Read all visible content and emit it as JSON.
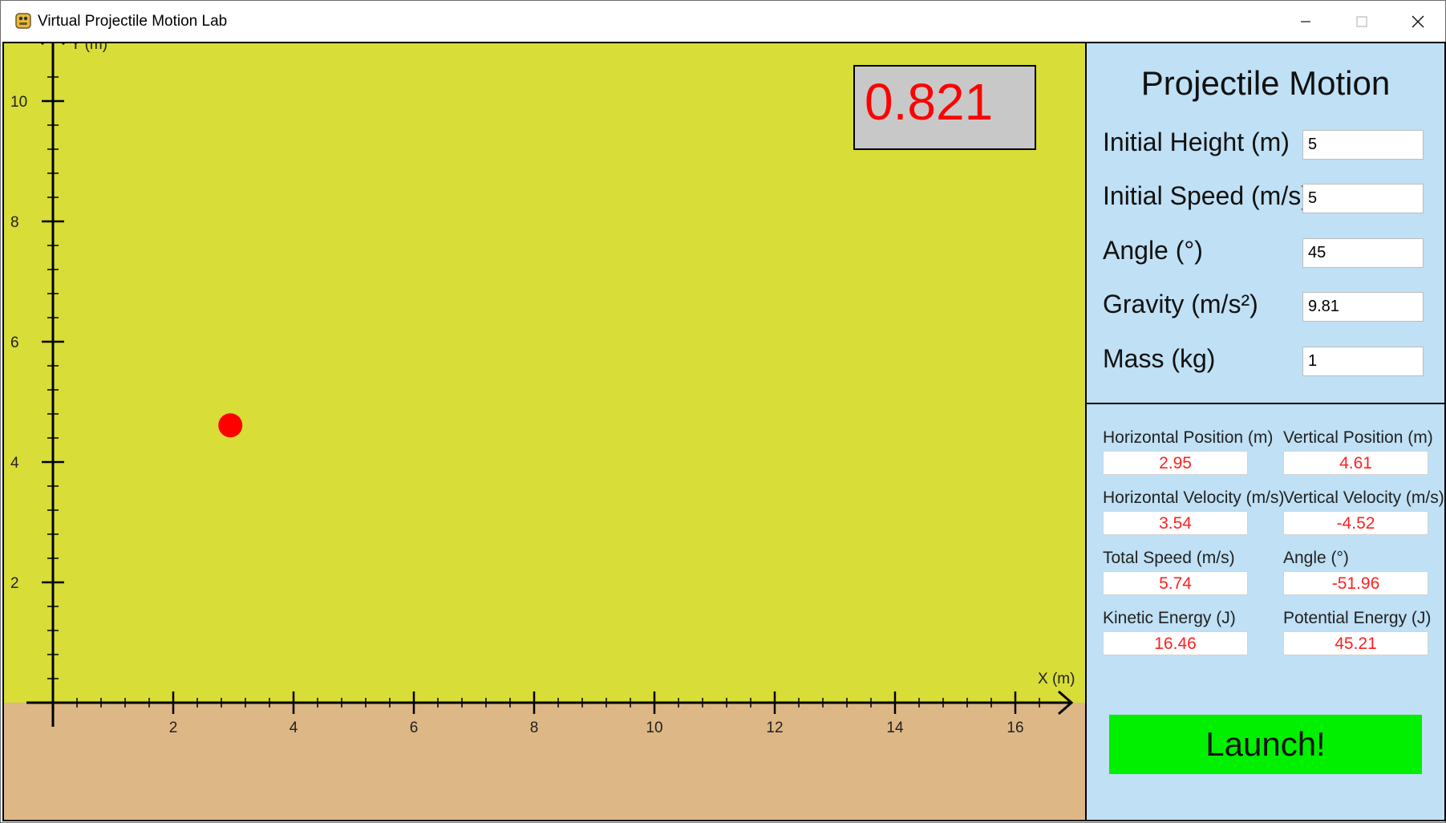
{
  "window": {
    "title": "Virtual Projectile Motion Lab",
    "icon": "python-icon",
    "controls": [
      "minimize-icon",
      "maximize-icon",
      "close-icon"
    ]
  },
  "canvas": {
    "sky_color": "#d8dd37",
    "ground_color": "#ddb786",
    "timer": "0.821",
    "projectile": {
      "x": 2.95,
      "y": 4.61,
      "color": "#ff0000"
    }
  },
  "chart_data": {
    "type": "scatter",
    "xlabel": "X (m)",
    "ylabel": "Y (m)",
    "xlim": [
      0,
      16.8
    ],
    "ylim": [
      0,
      11
    ],
    "x_ticks": [
      2,
      4,
      6,
      8,
      10,
      12,
      14,
      16
    ],
    "y_ticks": [
      2,
      4,
      6,
      8,
      10
    ],
    "minor_tick_step": 0.4,
    "series": [
      {
        "x": [
          2.95
        ],
        "y": [
          4.61
        ]
      }
    ]
  },
  "panel": {
    "title": "Projectile Motion",
    "params": [
      {
        "label": "Initial Height (m)",
        "value": "5"
      },
      {
        "label": "Initial Speed (m/s)",
        "value": "5"
      },
      {
        "label": "Angle (°)",
        "value": "45"
      },
      {
        "label": "Gravity (m/s²)",
        "value": "9.81"
      },
      {
        "label": "Mass (kg)",
        "value": "1"
      }
    ],
    "stats": [
      {
        "label": "Horizontal Position (m)",
        "value": "2.95"
      },
      {
        "label": "Vertical Position (m)",
        "value": "4.61"
      },
      {
        "label": "Horizontal Velocity (m/s)",
        "value": "3.54"
      },
      {
        "label": "Vertical Velocity (m/s)",
        "value": "-4.52"
      },
      {
        "label": "Total Speed (m/s)",
        "value": "5.74"
      },
      {
        "label": "Angle (°)",
        "value": "-51.96"
      },
      {
        "label": "Kinetic Energy (J)",
        "value": "16.46"
      },
      {
        "label": "Potential Energy (J)",
        "value": "45.21"
      }
    ],
    "launch_label": "Launch!",
    "background": "#bfe0f5",
    "launch_color": "#00f000"
  }
}
